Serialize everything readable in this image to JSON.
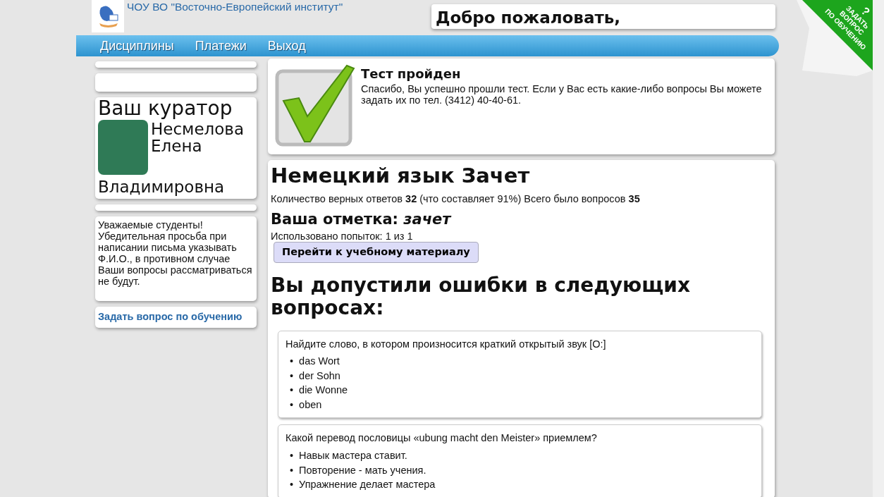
{
  "header": {
    "institute": "ЧОУ ВО \"Восточно-Европейский институт\"",
    "welcome": "Добро пожаловать,"
  },
  "corner_ribbon": {
    "mark": "?",
    "lines": [
      "ЗАДАТЬ",
      "ВОПРОС",
      "ПО ОБУЧЕНИЮ"
    ]
  },
  "nav": [
    {
      "label": "Дисциплины"
    },
    {
      "label": "Платежи"
    },
    {
      "label": "Выход"
    }
  ],
  "sidebar": {
    "curator_heading": "Ваш куратор",
    "curator_name": [
      "Несмелова",
      "Елена",
      "Владимировна"
    ],
    "notice": "Уважаемые студенты! Убедительная просьба при написании письма указывать Ф.И.О., в противном случае Ваши вопросы рассматриваться не будут.",
    "ask_link": "Задать вопрос по обучению"
  },
  "test_status": {
    "title": "Тест пройден",
    "message": "Спасибо, Вы успешно прошли тест. Если у Вас есть какие-либо вопросы Вы можете задать их по тел. (3412) 40-40-61."
  },
  "result": {
    "title": "Немецкий язык Зачет",
    "summary": "Количество верных ответов **32** (что составляет 91%) Всего было вопросов **35**",
    "mark_label": "Ваша отметка:",
    "mark_value": "зачет",
    "attempts": "Использовано попыток: 1 из 1",
    "button": "Перейти к учебному материалу",
    "errors_heading": "Вы допустили ошибки в следующих вопросах:"
  },
  "questions": [
    {
      "text": "Найдите слово, в котором произносится краткий открытый звук [O:]",
      "marker": "•",
      "options": [
        "das Wort",
        "der Sohn",
        "die Wonne",
        "oben"
      ]
    },
    {
      "text": "Какой перевод пословицы «ubung macht den Meister» приемлем?",
      "marker": "•",
      "options": [
        "Навык мастера ставит.",
        "Повторение - мать учения.",
        "Упражнение делает мастера"
      ]
    }
  ]
}
